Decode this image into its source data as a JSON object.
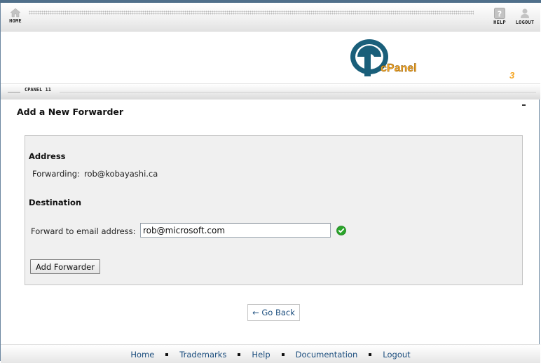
{
  "topbar": {
    "home_label": "HOME",
    "help_label": "HELP",
    "logout_label": "LOGOUT"
  },
  "brand": {
    "logo_text": "cPanel",
    "version_number": "3",
    "band_label": "CPANEL 11"
  },
  "page": {
    "title": "Add a New Forwarder"
  },
  "form": {
    "address_heading": "Address",
    "forwarding_label": "Forwarding:",
    "forwarding_value": "rob@kobayashi.ca",
    "destination_heading": "Destination",
    "forward_to_label": "Forward to email address:",
    "forward_to_value": "rob@microsoft.com",
    "submit_label": "Add Forwarder"
  },
  "nav": {
    "go_back_label": "← Go Back"
  },
  "footer": {
    "links": [
      "Home",
      "Trademarks",
      "Help",
      "Documentation",
      "Logout"
    ]
  },
  "colors": {
    "link": "#1c4e7e",
    "logo_blue": "#1a5f7a",
    "logo_orange": "#f5a623",
    "valid_green": "#2aa52a"
  },
  "icons": {
    "home": "home-icon",
    "help": "help-icon",
    "logout": "logout-icon",
    "valid": "check-circle-icon"
  }
}
